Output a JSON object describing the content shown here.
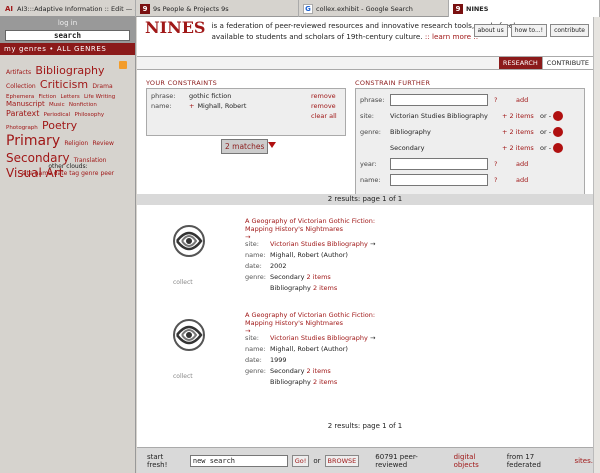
{
  "tabs": [
    {
      "icon": "AI",
      "label": "AI3:::Adaptive Information :: Edit — ..."
    },
    {
      "icon": "9",
      "label": "9s People & Projects 9s"
    },
    {
      "icon": "G",
      "label": "collex.exhibit - Google Search"
    },
    {
      "icon": "9",
      "label": "NINES"
    }
  ],
  "sidebar": {
    "login": "log in",
    "search_value": "search",
    "genres_bar": "my genres • ALL GENRES",
    "cloud": [
      {
        "t": "Artifacts",
        "s": 6
      },
      {
        "t": "Bibliography",
        "s": 11
      },
      {
        "t": "Collection",
        "s": 6
      },
      {
        "t": "Criticism",
        "s": 11
      },
      {
        "t": "Drama",
        "s": 6
      },
      {
        "t": "Ephemera",
        "s": 5.5
      },
      {
        "t": "Fiction",
        "s": 5.5
      },
      {
        "t": "Letters",
        "s": 5.5
      },
      {
        "t": "Life Writing",
        "s": 5.5
      },
      {
        "t": "Manuscript",
        "s": 7
      },
      {
        "t": "Music",
        "s": 5.5
      },
      {
        "t": "Nonfiction",
        "s": 5.5
      },
      {
        "t": "Paratext",
        "s": 8
      },
      {
        "t": "Periodical",
        "s": 5.5
      },
      {
        "t": "Philosophy",
        "s": 5.5
      },
      {
        "t": "Photograph",
        "s": 5.5
      },
      {
        "t": "Poetry",
        "s": 11
      },
      {
        "t": "Primary",
        "s": 14
      },
      {
        "t": "Religion",
        "s": 6
      },
      {
        "t": "Review",
        "s": 6
      },
      {
        "t": "Secondary",
        "s": 12
      },
      {
        "t": "Translation",
        "s": 6
      },
      {
        "t": "Visual Art",
        "s": 12
      }
    ],
    "other_clouds_label": "other clouds:",
    "other_clouds": [
      "site",
      "name",
      "date",
      "tag",
      "genre",
      "peer"
    ]
  },
  "header": {
    "logo": "NINES",
    "blurb": "is a federation of peer-reviewed resources and innovative research tools, made freely available to students and scholars of 19th-century culture.",
    "learn_more": ":: learn more ::",
    "buttons": [
      "about us",
      "how to...!",
      "contribute"
    ],
    "modes": [
      "RESEARCH",
      "CONTRIBUTE"
    ]
  },
  "constraints": {
    "title": "YOUR CONSTRAINTS",
    "rows": [
      {
        "label": "phrase:",
        "value": "gothic fiction",
        "action": "remove",
        "plus": ""
      },
      {
        "label": "name:",
        "value": "Mighall, Robert",
        "action": "remove",
        "plus": "+"
      },
      {
        "label": "",
        "value": "",
        "action": "clear all",
        "plus": ""
      }
    ],
    "matches": "2 matches"
  },
  "further": {
    "title": "CONSTRAIN FURTHER",
    "phrase_label": "phrase:",
    "q": "?",
    "add": "add",
    "site_label": "site:",
    "site_value": "Victorian Studies Bibliography",
    "items": "+ 2 items",
    "or": "or -",
    "genre_label": "genre:",
    "genre_values": [
      "Bibliography",
      "Secondary"
    ],
    "year_label": "year:",
    "name_label": "name:"
  },
  "results_bar": "2 results: page 1 of 1",
  "results": [
    {
      "title": "A Geography of Victorian Gothic Fiction: Mapping History's Nightmares",
      "arrow": "→",
      "site_label": "site:",
      "site": "Victorian Studies Bibliography",
      "name_label": "name:",
      "name": "Mighall, Robert (Author)",
      "date_label": "date:",
      "date": "2002",
      "genre_label": "genre:",
      "genre1": "Secondary",
      "genre2": "Bibliography",
      "items": "2 items",
      "collect": "collect"
    },
    {
      "title": "A Geography of Victorian Gothic Fiction: Mapping History's Nightmares",
      "arrow": "→",
      "site_label": "site:",
      "site": "Victorian Studies Bibliography",
      "name_label": "name:",
      "name": "Mighall, Robert (Author)",
      "date_label": "date:",
      "date": "1999",
      "genre_label": "genre:",
      "genre1": "Secondary",
      "genre2": "Bibliography",
      "items": "2 items",
      "collect": "collect"
    }
  ],
  "footer": {
    "start_fresh": "start fresh!",
    "input_value": "new search",
    "go": "Go!",
    "or": "or",
    "browse": "BROWSE",
    "count_text": "60791 peer-reviewed",
    "digital_objects": "digital objects",
    "from_text": "from 17 federated",
    "sites": "sites."
  }
}
